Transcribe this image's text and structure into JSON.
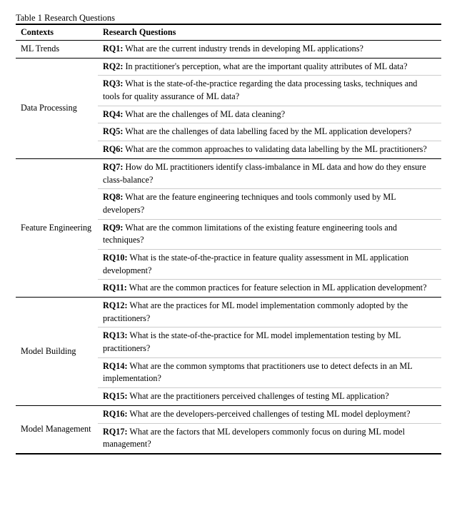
{
  "title": {
    "label": "Table 1",
    "description": "Research Questions"
  },
  "columns": {
    "col1": "Contexts",
    "col2": "Research Questions"
  },
  "sections": [
    {
      "context": "ML Trends",
      "rows": [
        {
          "rq": "RQ1:",
          "text": " What are the current industry trends in developing ML applications?"
        }
      ]
    },
    {
      "context": "Data Processing",
      "rows": [
        {
          "rq": "RQ2:",
          "text": " In practitioner's perception, what are the important quality attributes of ML data?"
        },
        {
          "rq": "RQ3:",
          "text": " What is the state-of-the-practice regarding the data processing tasks, techniques and tools for quality assurance of ML data?"
        },
        {
          "rq": "RQ4:",
          "text": " What are the challenges of ML data cleaning?"
        },
        {
          "rq": "RQ5:",
          "text": " What are the challenges of data labelling faced by the ML application developers?"
        },
        {
          "rq": "RQ6:",
          "text": " What are the common approaches to validating data labelling by the ML practitioners?"
        }
      ]
    },
    {
      "context": "Feature Engineering",
      "rows": [
        {
          "rq": "RQ7:",
          "text": " How do ML practitioners identify class-imbalance in ML data and how do they ensure class-balance?"
        },
        {
          "rq": "RQ8:",
          "text": " What are the feature engineering techniques and tools commonly used by ML developers?"
        },
        {
          "rq": "RQ9:",
          "text": " What are the common limitations of the existing feature engineering tools and techniques?"
        },
        {
          "rq": "RQ10:",
          "text": " What is the state-of-the-practice in feature quality assessment in ML application development?"
        },
        {
          "rq": "RQ11:",
          "text": " What are the common practices for feature selection in ML application development?"
        }
      ]
    },
    {
      "context": "Model Building",
      "rows": [
        {
          "rq": "RQ12:",
          "text": " What are the practices for ML model implementation commonly adopted by the practitioners?"
        },
        {
          "rq": "RQ13:",
          "text": " What is the state-of-the-practice for ML model implementation testing by ML practitioners?"
        },
        {
          "rq": "RQ14:",
          "text": " What are the common symptoms that practitioners use to detect defects in an ML implementation?"
        },
        {
          "rq": "RQ15:",
          "text": " What are the practitioners perceived challenges of testing ML application?"
        }
      ]
    },
    {
      "context": "Model Management",
      "rows": [
        {
          "rq": "RQ16:",
          "text": " What are the developers-perceived challenges of testing ML model deployment?"
        },
        {
          "rq": "RQ17:",
          "text": " What are the factors that ML developers commonly focus on during ML model management?"
        }
      ]
    }
  ]
}
